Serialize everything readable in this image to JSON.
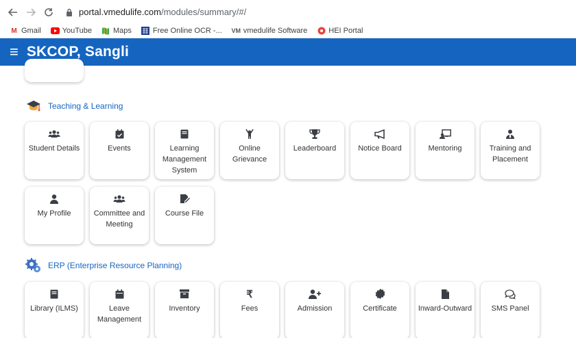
{
  "browser": {
    "url_host": "portal.vmedulife.com",
    "url_path": "/modules/summary/#/",
    "bookmarks": [
      {
        "label": "Gmail",
        "icon": "gmail-icon"
      },
      {
        "label": "YouTube",
        "icon": "youtube-icon"
      },
      {
        "label": "Maps",
        "icon": "maps-icon"
      },
      {
        "label": "Free Online OCR -...",
        "icon": "ocr-icon"
      },
      {
        "label": "vmedulife Software",
        "icon": "vmedulife-icon"
      },
      {
        "label": "HEI Portal",
        "icon": "hei-icon"
      }
    ]
  },
  "header": {
    "title": "SKCOP, Sangli"
  },
  "sections": {
    "teaching": {
      "title": "Teaching & Learning",
      "cards": [
        {
          "label": "Student Details",
          "icon": "users-icon"
        },
        {
          "label": "Events",
          "icon": "calendar-check-icon"
        },
        {
          "label": "Learning Management System",
          "icon": "book-icon"
        },
        {
          "label": "Online Grievance",
          "icon": "person-raise-icon"
        },
        {
          "label": "Leaderboard",
          "icon": "trophy-icon"
        },
        {
          "label": "Notice Board",
          "icon": "megaphone-icon"
        },
        {
          "label": "Mentoring",
          "icon": "chalkboard-teacher-icon"
        },
        {
          "label": "Training and Placement",
          "icon": "person-tie-icon"
        },
        {
          "label": "My Profile",
          "icon": "user-icon"
        },
        {
          "label": "Committee and Meeting",
          "icon": "users-icon"
        },
        {
          "label": "Course File",
          "icon": "file-edit-icon"
        }
      ]
    },
    "erp": {
      "title": "ERP (Enterprise Resource Planning)",
      "cards": [
        {
          "label": "Library (ILMS)",
          "icon": "book-icon"
        },
        {
          "label": "Leave Management",
          "icon": "calendar-icon"
        },
        {
          "label": "Inventory",
          "icon": "archive-icon"
        },
        {
          "label": "Fees",
          "icon": "rupee-icon"
        },
        {
          "label": "Admission",
          "icon": "user-plus-icon"
        },
        {
          "label": "Certificate",
          "icon": "certificate-icon"
        },
        {
          "label": "Inward-Outward",
          "icon": "file-icon"
        },
        {
          "label": "SMS Panel",
          "icon": "comments-icon"
        }
      ]
    }
  },
  "colors": {
    "header_bg": "#1565c0",
    "section_title": "#1565c0",
    "icon": "#3b3f45"
  }
}
